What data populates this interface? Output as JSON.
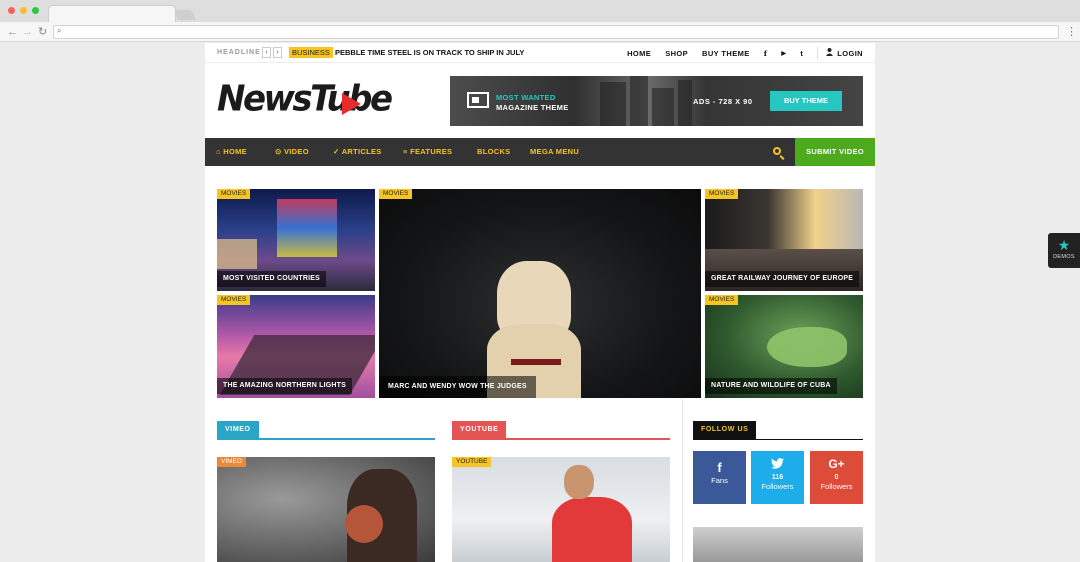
{
  "topbar": {
    "headline_label": "HEADLINE",
    "prev": "‹",
    "next": "›",
    "category": "BUSINESS",
    "headline": "PEBBLE TIME STEEL IS ON TRACK TO SHIP IN JULY",
    "links": [
      "HOME",
      "SHOP",
      "BUY THEME"
    ],
    "social_icons": [
      "f",
      "▶",
      "t"
    ],
    "login": "LOGIN"
  },
  "logo": {
    "text": "NewsTube"
  },
  "ad": {
    "line1": "MOST WANTED",
    "line2": "MAGAZINE THEME",
    "size": "ADS - 728 X 90",
    "button": "BUY THEME"
  },
  "nav": {
    "items": [
      "HOME",
      "VIDEO",
      "ARTICLES",
      "FEATURES",
      "BLOCKS",
      "MEGA MENU"
    ],
    "submit": "SUBMIT VIDEO"
  },
  "featured": [
    {
      "tag": "MOVIES",
      "title": "MOST VISITED COUNTRIES"
    },
    {
      "tag": "MOVIES",
      "title": "THE AMAZING NORTHERN LIGHTS"
    },
    {
      "tag": "MOVIES",
      "title": "MARC AND WENDY WOW THE JUDGES"
    },
    {
      "tag": "MOVIES",
      "title": "GREAT RAILWAY JOURNEY OF EUROPE"
    },
    {
      "tag": "MOVIES",
      "title": "NATURE AND WILDLIFE OF CUBA"
    }
  ],
  "sections": [
    {
      "label": "VIMEO",
      "tag": "VIMEO",
      "color": "#2ba4c6"
    },
    {
      "label": "YOUTUBE",
      "tag": "YOUTUBE",
      "color": "#e45454"
    }
  ],
  "follow": {
    "label": "FOLLOW US",
    "facebook": {
      "count": "",
      "label": "Fans",
      "color": "#3b5998"
    },
    "twitter": {
      "count": "116",
      "label": "Followers",
      "color": "#1dadeb"
    },
    "gplus": {
      "count": "0",
      "label": "Followers",
      "color": "#dd4b39"
    }
  },
  "demos": {
    "label": "DEMOS"
  }
}
